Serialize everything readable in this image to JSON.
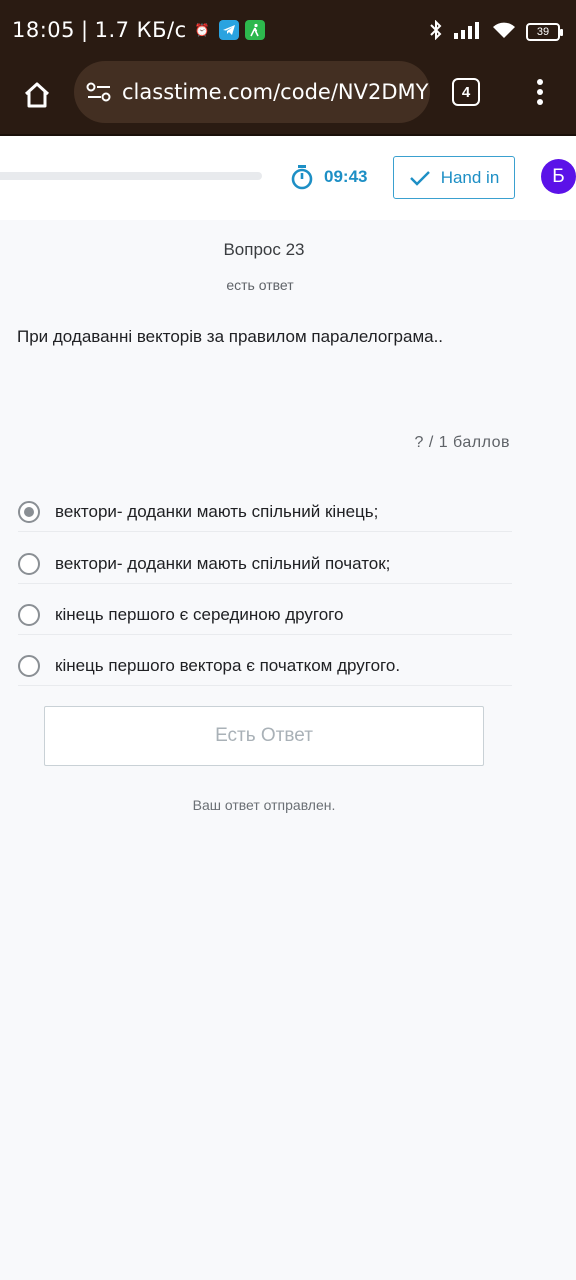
{
  "status_bar": {
    "time": "18:05",
    "speed": "1.7 КБ/с",
    "battery": "39"
  },
  "browser": {
    "url": "classtime.com/code/NV2DMY",
    "tab_count": "4"
  },
  "header": {
    "timer": "09:43",
    "hand_in_label": "Hand in",
    "avatar_letter": "Б"
  },
  "question": {
    "number": "Вопрос 23",
    "status": "есть ответ",
    "text": "При додаванні векторів за правилом паралелограма..",
    "points": "?  /  1  баллов"
  },
  "options": [
    {
      "label": "вектори- доданки мають спільний кінець;",
      "selected": true
    },
    {
      "label": "вектори- доданки мають спільний початок;",
      "selected": false
    },
    {
      "label": "кінець першого є серединою другого",
      "selected": false
    },
    {
      "label": "кінець першого вектора є початком другого.",
      "selected": false
    }
  ],
  "submit_label": "Есть Ответ",
  "sent_message": "Ваш ответ отправлен.",
  "colors": {
    "accent": "#1d8fc5",
    "avatar": "#5b12e8",
    "browser_bg": "#2a1b12"
  }
}
